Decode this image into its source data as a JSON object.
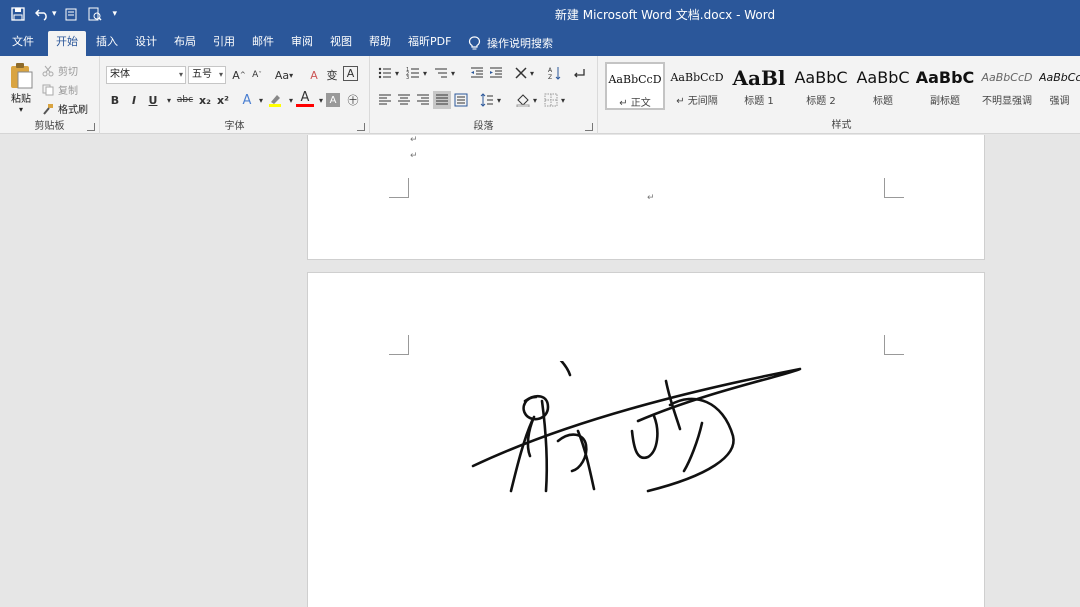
{
  "app": {
    "doc_title": "新建 Microsoft Word 文档.docx  -  Word"
  },
  "tabs": [
    {
      "label": "文件"
    },
    {
      "label": "开始"
    },
    {
      "label": "插入"
    },
    {
      "label": "设计"
    },
    {
      "label": "布局"
    },
    {
      "label": "引用"
    },
    {
      "label": "邮件"
    },
    {
      "label": "审阅"
    },
    {
      "label": "视图"
    },
    {
      "label": "帮助"
    },
    {
      "label": "福昕PDF"
    },
    {
      "label": "操作说明搜索"
    }
  ],
  "clipboard": {
    "paste": "粘贴",
    "cut": "剪切",
    "copy": "复制",
    "format_painter": "格式刷",
    "group": "剪贴板"
  },
  "font": {
    "name": "宋体",
    "size": "五号",
    "case": "Aa",
    "group": "字体",
    "bold": "B",
    "italic": "I",
    "underline": "U",
    "strike": "abc",
    "subscript": "x₂",
    "superscript": "x²",
    "grow": "A",
    "shrink": "A",
    "text_effect": "A",
    "font_color": "A",
    "char_shade": "A",
    "char_border": "A",
    "clear_format": "A",
    "phonetic": "变",
    "enclose": "㊉"
  },
  "paragraph": {
    "group": "段落"
  },
  "styles": {
    "group": "样式",
    "items": [
      {
        "sample": "AaBbCcD",
        "name": "↵ 正文"
      },
      {
        "sample": "AaBbCcD",
        "name": "↵ 无间隔"
      },
      {
        "sample": "AaBl",
        "name": "标题 1"
      },
      {
        "sample": "AaBbC",
        "name": "标题 2"
      },
      {
        "sample": "AaBbC",
        "name": "标题"
      },
      {
        "sample": "AaBbC",
        "name": "副标题"
      },
      {
        "sample": "AaBbCcD",
        "name": "不明显强调"
      },
      {
        "sample": "AaBbCc",
        "name": "强调"
      }
    ]
  },
  "document": {
    "para_mark": "↵"
  },
  "colors": {
    "accent": "#2b579a",
    "ribbon_bg": "#f3f3f3",
    "highlight": "#ffff00",
    "font_color": "#ff0000"
  }
}
